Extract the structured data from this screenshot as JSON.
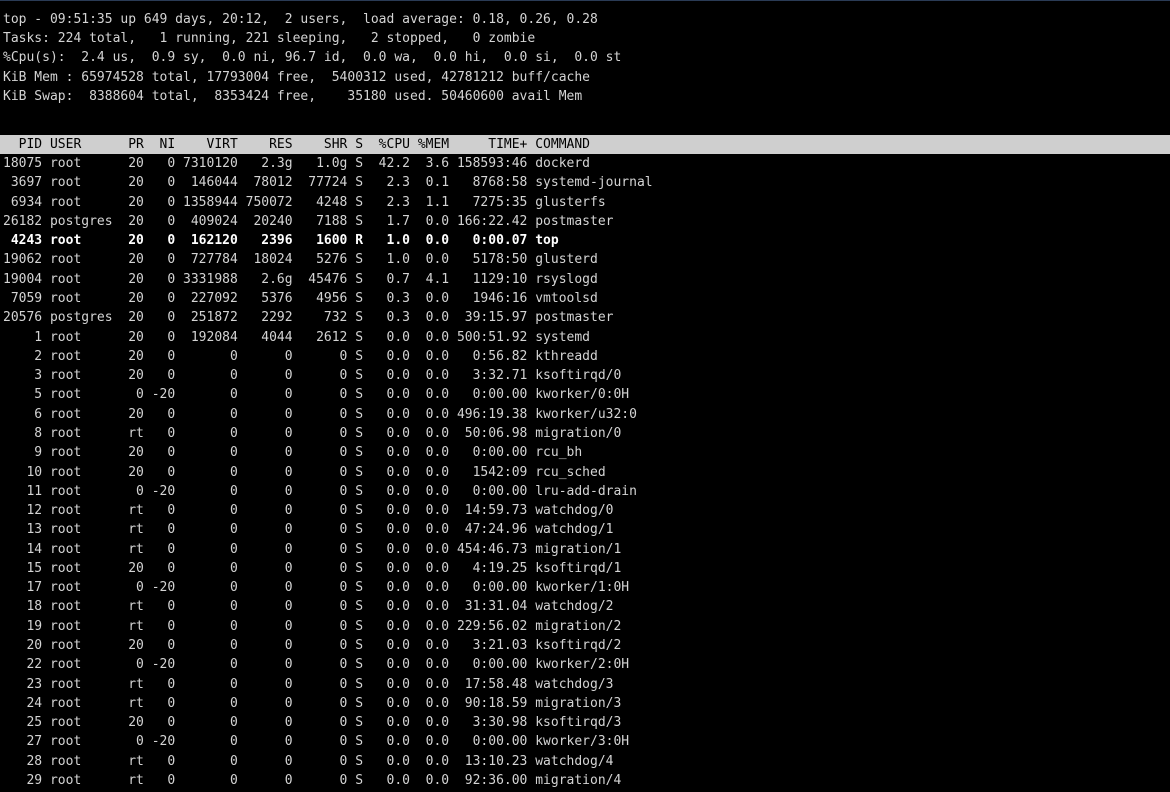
{
  "summary": [
    "top - 09:51:35 up 649 days, 20:12,  2 users,  load average: 0.18, 0.26, 0.28",
    "Tasks: 224 total,   1 running, 221 sleeping,   2 stopped,   0 zombie",
    "%Cpu(s):  2.4 us,  0.9 sy,  0.0 ni, 96.7 id,  0.0 wa,  0.0 hi,  0.0 si,  0.0 st",
    "KiB Mem : 65974528 total, 17793004 free,  5400312 used, 42781212 buff/cache",
    "KiB Swap:  8388604 total,  8353424 free,    35180 used. 50460600 avail Mem"
  ],
  "header": "  PID USER      PR  NI    VIRT    RES    SHR S  %CPU %MEM     TIME+ COMMAND",
  "process_rows": [
    "18075 root      20   0 7310120   2.3g   1.0g S  42.2  3.6 158593:46 dockerd",
    " 3697 root      20   0  146044  78012  77724 S   2.3  0.1   8768:58 systemd-journal",
    " 6934 root      20   0 1358944 750072   4248 S   2.3  1.1   7275:35 glusterfs",
    "26182 postgres  20   0  409024  20240   7188 S   1.7  0.0 166:22.42 postmaster",
    " 4243 root      20   0  162120   2396   1600 R   1.0  0.0   0:00.07 top",
    "19062 root      20   0  727784  18024   5276 S   1.0  0.0   5178:50 glusterd",
    "19004 root      20   0 3331988   2.6g  45476 S   0.7  4.1   1129:10 rsyslogd",
    " 7059 root      20   0  227092   5376   4956 S   0.3  0.0   1946:16 vmtoolsd",
    "20576 postgres  20   0  251872   2292    732 S   0.3  0.0  39:15.97 postmaster",
    "    1 root      20   0  192084   4044   2612 S   0.0  0.0 500:51.92 systemd",
    "    2 root      20   0       0      0      0 S   0.0  0.0   0:56.82 kthreadd",
    "    3 root      20   0       0      0      0 S   0.0  0.0   3:32.71 ksoftirqd/0",
    "    5 root       0 -20       0      0      0 S   0.0  0.0   0:00.00 kworker/0:0H",
    "    6 root      20   0       0      0      0 S   0.0  0.0 496:19.38 kworker/u32:0",
    "    8 root      rt   0       0      0      0 S   0.0  0.0  50:06.98 migration/0",
    "    9 root      20   0       0      0      0 S   0.0  0.0   0:00.00 rcu_bh",
    "   10 root      20   0       0      0      0 S   0.0  0.0   1542:09 rcu_sched",
    "   11 root       0 -20       0      0      0 S   0.0  0.0   0:00.00 lru-add-drain",
    "   12 root      rt   0       0      0      0 S   0.0  0.0  14:59.73 watchdog/0",
    "   13 root      rt   0       0      0      0 S   0.0  0.0  47:24.96 watchdog/1",
    "   14 root      rt   0       0      0      0 S   0.0  0.0 454:46.73 migration/1",
    "   15 root      20   0       0      0      0 S   0.0  0.0   4:19.25 ksoftirqd/1",
    "   17 root       0 -20       0      0      0 S   0.0  0.0   0:00.00 kworker/1:0H",
    "   18 root      rt   0       0      0      0 S   0.0  0.0  31:31.04 watchdog/2",
    "   19 root      rt   0       0      0      0 S   0.0  0.0 229:56.02 migration/2",
    "   20 root      20   0       0      0      0 S   0.0  0.0   3:21.03 ksoftirqd/2",
    "   22 root       0 -20       0      0      0 S   0.0  0.0   0:00.00 kworker/2:0H",
    "   23 root      rt   0       0      0      0 S   0.0  0.0  17:58.48 watchdog/3",
    "   24 root      rt   0       0      0      0 S   0.0  0.0  90:18.59 migration/3",
    "   25 root      20   0       0      0      0 S   0.0  0.0   3:30.98 ksoftirqd/3",
    "   27 root       0 -20       0      0      0 S   0.0  0.0   0:00.00 kworker/3:0H",
    "   28 root      rt   0       0      0      0 S   0.0  0.0  13:10.23 watchdog/4",
    "   29 root      rt   0       0      0      0 S   0.0  0.0  92:36.00 migration/4"
  ],
  "highlighted_row": 4,
  "colors": {
    "background": "#000000",
    "text": "#d4d4d4",
    "header_bar": "#cfcfcf",
    "highlight_text": "#ffffff"
  }
}
